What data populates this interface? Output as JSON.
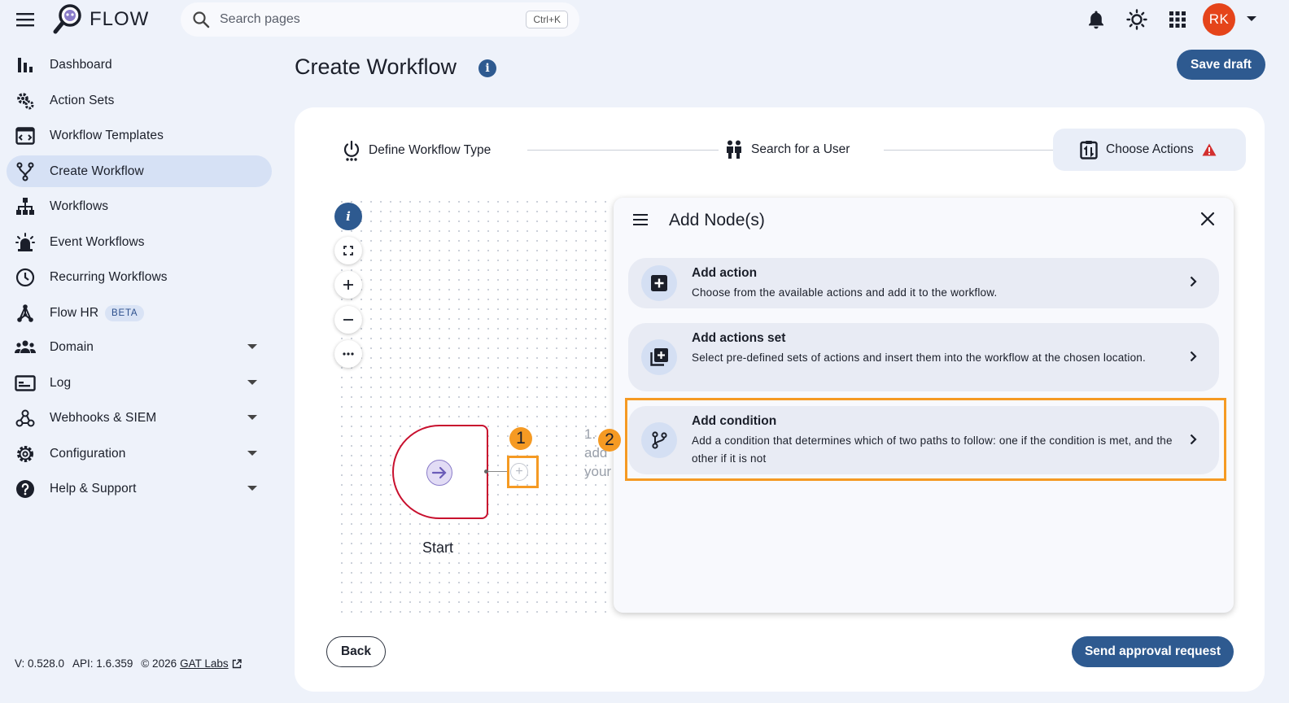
{
  "app": {
    "name": "FLOW"
  },
  "search": {
    "placeholder": "Search pages",
    "shortcut": "Ctrl+K"
  },
  "user": {
    "initials": "RK"
  },
  "sidebar": {
    "items": [
      {
        "label": "Dashboard",
        "icon": "bar-chart-icon"
      },
      {
        "label": "Action Sets",
        "icon": "gears-icon"
      },
      {
        "label": "Workflow Templates",
        "icon": "template-icon"
      },
      {
        "label": "Create Workflow",
        "icon": "fork-icon",
        "active": true
      },
      {
        "label": "Workflows",
        "icon": "hierarchy-icon"
      },
      {
        "label": "Event Workflows",
        "icon": "alarm-icon"
      },
      {
        "label": "Recurring Workflows",
        "icon": "clock-icon"
      },
      {
        "label": "Flow HR",
        "icon": "network-icon",
        "badge": "BETA"
      },
      {
        "label": "Domain",
        "icon": "group-icon",
        "expandable": true
      },
      {
        "label": "Log",
        "icon": "log-icon",
        "expandable": true
      },
      {
        "label": "Webhooks & SIEM",
        "icon": "webhook-icon",
        "expandable": true
      },
      {
        "label": "Configuration",
        "icon": "gear-icon",
        "expandable": true
      },
      {
        "label": "Help & Support",
        "icon": "help-icon",
        "expandable": true
      }
    ],
    "footer": {
      "version": "V: 0.528.0",
      "api": "API: 1.6.359",
      "copyright": "© 2026",
      "link": "GAT Labs"
    }
  },
  "header": {
    "title": "Create Workflow",
    "save_label": "Save draft"
  },
  "stepper": {
    "steps": [
      {
        "label": "Define Workflow Type"
      },
      {
        "label": "Search for a User"
      },
      {
        "label": "Choose Actions",
        "warning": true,
        "active": true
      }
    ]
  },
  "canvas": {
    "start_label": "Start",
    "hint_lines": [
      "1.",
      "add",
      "your"
    ],
    "badges": [
      "1",
      "2"
    ]
  },
  "panel": {
    "title": "Add Node(s)",
    "options": [
      {
        "title": "Add action",
        "description": "Choose from the available actions and add it to the workflow.",
        "icon": "plus-box-icon"
      },
      {
        "title": "Add actions set",
        "description": "Select pre-defined sets of actions and insert them into the workflow at the chosen location.",
        "icon": "plus-stack-icon"
      },
      {
        "title": "Add condition",
        "description": "Add a condition that determines which of two paths to follow: one if the condition is met, and the other if it is not",
        "icon": "branch-icon"
      }
    ]
  },
  "footer": {
    "back_label": "Back",
    "send_label": "Send approval request"
  },
  "colors": {
    "primary": "#2e5a90",
    "highlight": "#f59a23",
    "start_border": "#c8102e",
    "avatar": "#e5441a",
    "warning": "#d32f2f"
  }
}
